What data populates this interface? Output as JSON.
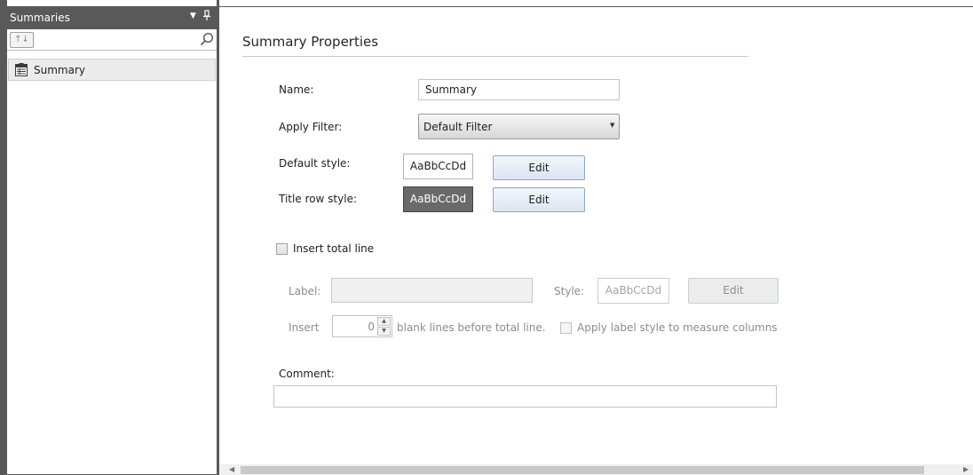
{
  "panel": {
    "title": "Summaries",
    "dropdown_icon": "dropdown-arrow-icon",
    "pin_icon": "pin-icon",
    "sort_button_label": "↑↓",
    "search_value": "",
    "search_icon": "search-icon",
    "items": [
      {
        "label": "Summary",
        "icon": "summary-table-icon"
      }
    ]
  },
  "form": {
    "title": "Summary Properties",
    "name_label": "Name:",
    "name_value": "Summary",
    "apply_filter_label": "Apply Filter:",
    "apply_filter_value": "Default Filter",
    "default_style_label": "Default style:",
    "default_style_preview": "AaBbCcDd",
    "title_row_style_label": "Title row style:",
    "title_row_style_preview": "AaBbCcDd",
    "edit_label": "Edit",
    "insert_total_line_label": "Insert total line",
    "insert_total_line_checked": false,
    "total_label_label": "Label:",
    "total_label_value": "",
    "style_label": "Style:",
    "style_preview": "AaBbCcDd",
    "insert_label": "Insert",
    "blank_lines_value": "0",
    "blank_lines_suffix": "blank lines before total line.",
    "apply_label_style_label": "Apply label style to measure columns",
    "apply_label_style_checked": false,
    "comment_label": "Comment:",
    "comment_value": ""
  },
  "colors": {
    "panel_header": "#595959",
    "dark_style_preview": "#6a6a6a",
    "edit_button": "#dbe5f1"
  }
}
